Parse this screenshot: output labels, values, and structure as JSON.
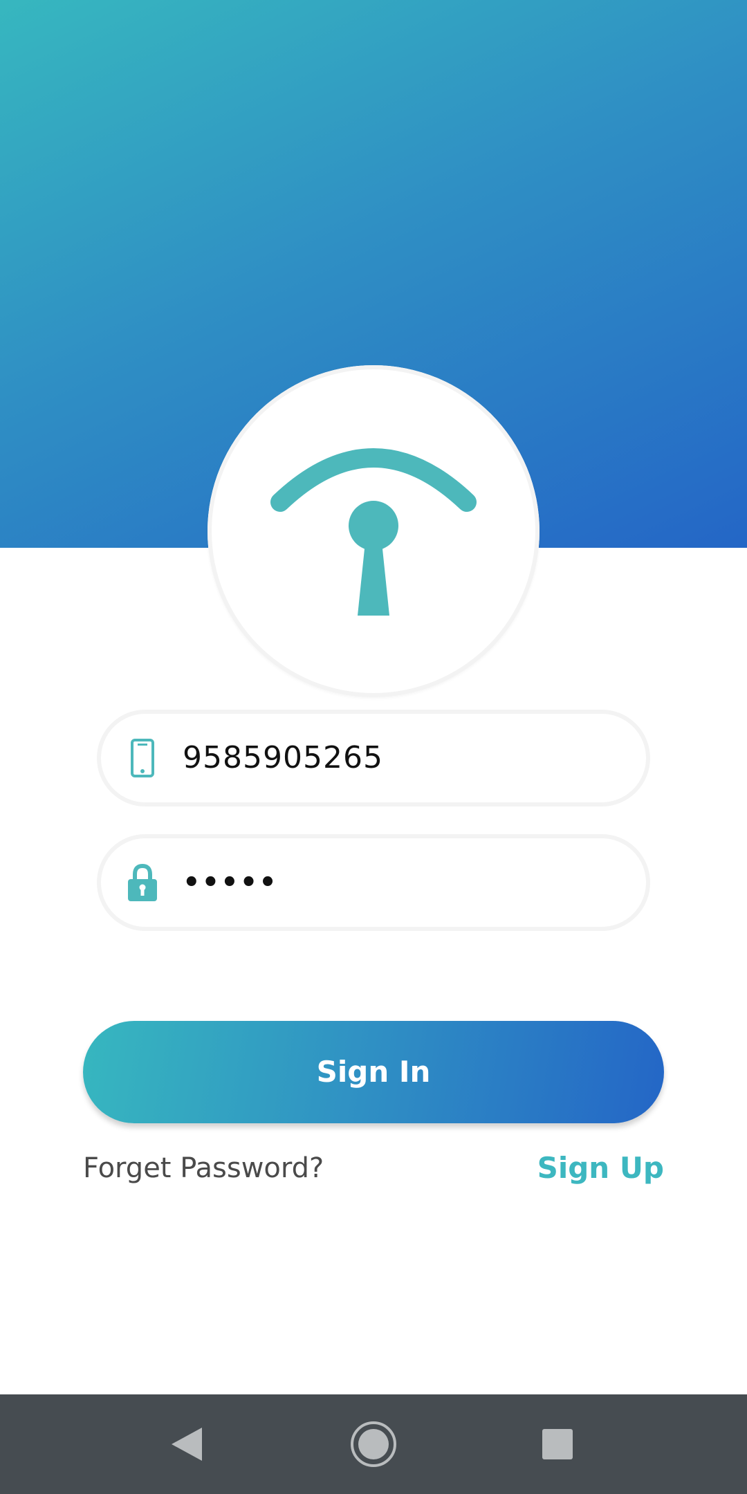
{
  "colors": {
    "gradient_start": "#37b7bf",
    "gradient_end": "#2466c6",
    "accent": "#4db8bb",
    "signup_text": "#3db7c0",
    "nav_bar": "#464c51"
  },
  "logo": {
    "icon": "signal-keyhole-logo-icon"
  },
  "form": {
    "phone": {
      "icon": "phone-icon",
      "value": "9585905265"
    },
    "password": {
      "icon": "lock-icon",
      "value": "•••••"
    }
  },
  "actions": {
    "sign_in_label": "Sign In",
    "forgot_label": "Forget Password?",
    "sign_up_label": "Sign Up"
  },
  "nav": {
    "back_icon": "back-triangle-icon",
    "home_icon": "home-circle-icon",
    "recents_icon": "recents-square-icon"
  }
}
